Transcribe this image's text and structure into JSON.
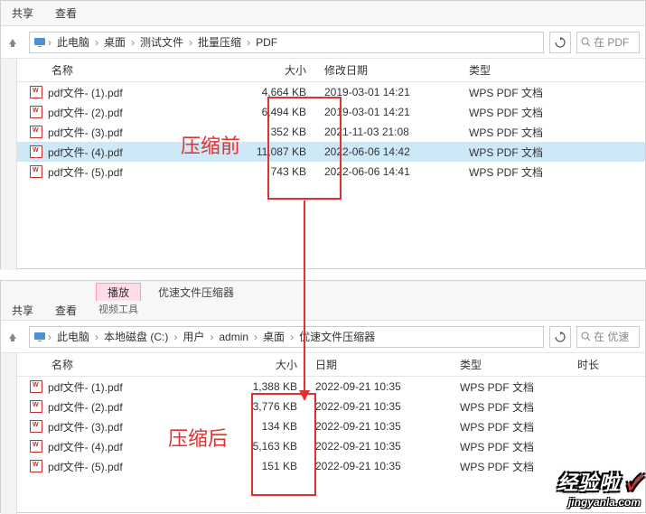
{
  "top": {
    "ribbon": {
      "share": "共享",
      "view": "查看"
    },
    "crumbs": [
      "此电脑",
      "桌面",
      "测试文件",
      "批量压缩",
      "PDF"
    ],
    "search_ph": "在 PDF",
    "cols": {
      "name": "名称",
      "size": "大小",
      "date": "修改日期",
      "type": "类型"
    },
    "rows": [
      {
        "name": "pdf文件- (1).pdf",
        "size": "4,664 KB",
        "date": "2019-03-01 14:21",
        "type": "WPS PDF 文档",
        "sel": false
      },
      {
        "name": "pdf文件- (2).pdf",
        "size": "6,494 KB",
        "date": "2019-03-01 14:21",
        "type": "WPS PDF 文档",
        "sel": false
      },
      {
        "name": "pdf文件- (3).pdf",
        "size": "352 KB",
        "date": "2021-11-03 21:08",
        "type": "WPS PDF 文档",
        "sel": false
      },
      {
        "name": "pdf文件- (4).pdf",
        "size": "11,087 KB",
        "date": "2022-06-06 14:42",
        "type": "WPS PDF 文档",
        "sel": true
      },
      {
        "name": "pdf文件- (5).pdf",
        "size": "743 KB",
        "date": "2022-06-06 14:41",
        "type": "WPS PDF 文档",
        "sel": false
      }
    ]
  },
  "bottom": {
    "ribbon": {
      "share": "共享",
      "view": "查看",
      "play": "播放",
      "tools": "视频工具",
      "title": "优速文件压缩器"
    },
    "crumbs": [
      "此电脑",
      "本地磁盘 (C:)",
      "用户",
      "admin",
      "桌面",
      "优速文件压缩器"
    ],
    "search_ph": "在 优速",
    "cols": {
      "name": "名称",
      "size": "大小",
      "date": "日期",
      "type": "类型",
      "dur": "时长"
    },
    "rows": [
      {
        "name": "pdf文件- (1).pdf",
        "size": "1,388 KB",
        "date": "2022-09-21 10:35",
        "type": "WPS PDF 文档"
      },
      {
        "name": "pdf文件- (2).pdf",
        "size": "3,776 KB",
        "date": "2022-09-21 10:35",
        "type": "WPS PDF 文档"
      },
      {
        "name": "pdf文件- (3).pdf",
        "size": "134 KB",
        "date": "2022-09-21 10:35",
        "type": "WPS PDF 文档"
      },
      {
        "name": "pdf文件- (4).pdf",
        "size": "5,163 KB",
        "date": "2022-09-21 10:35",
        "type": "WPS PDF 文档"
      },
      {
        "name": "pdf文件- (5).pdf",
        "size": "151 KB",
        "date": "2022-09-21 10:35",
        "type": "WPS PDF 文档"
      }
    ]
  },
  "annot": {
    "before": "压缩前",
    "after": "压缩后"
  },
  "watermark": {
    "big": "经验啦",
    "check": "✓",
    "small": "jingyanla.com"
  }
}
